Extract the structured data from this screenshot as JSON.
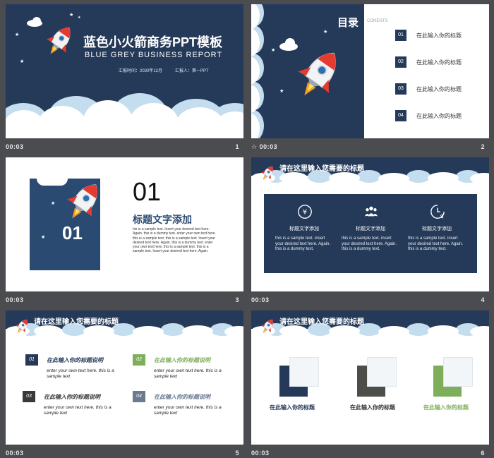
{
  "colors": {
    "navy": "#253a59",
    "cloud_blue": "#c4ddef",
    "green": "#7fae5b",
    "dark_gray": "#4d4d4a",
    "slate": "#6a7a90",
    "rocket_red": "#e53a30",
    "flame": "#f29b1e"
  },
  "slides": [
    {
      "time": "00:03",
      "number": "1",
      "title": "蓝色小火箭商务PPT模板",
      "subtitle": "BLUE GREY BUSINESS REPORT",
      "info_time": "汇报时间：2030年12月",
      "info_person": "汇报人：第一PPT"
    },
    {
      "time": "00:03",
      "number": "2",
      "heading": "目录",
      "contents_label": "CONENTS",
      "toc": [
        {
          "num": "01",
          "label": "在此输入你的标题"
        },
        {
          "num": "02",
          "label": "在此输入你的标题"
        },
        {
          "num": "03",
          "label": "在此输入你的标题"
        },
        {
          "num": "04",
          "label": "在此输入你的标题"
        }
      ]
    },
    {
      "time": "00:03",
      "number": "3",
      "big_number": "01",
      "panel_number": "01",
      "heading": "标题文字添加",
      "paragraph": "his is a sample text. Insert your desired text here. Again. this is a dummy text. enter your own text here. this is a sample text. this is a sample text. Insert your desired text here. Again. this is a dummy text. enter your own text here. this is a sample text. this is a sample text. Insert your desired text here. Again."
    },
    {
      "time": "00:03",
      "number": "4",
      "band_title": "请在这里输入您需要的标题",
      "columns": [
        {
          "icon": "yen-coin-icon",
          "title": "标题文字添加",
          "desc": "this is a sample text. insert your desired text here. Again. this is a dummy text."
        },
        {
          "icon": "people-group-icon",
          "title": "标题文字添加",
          "desc": "this is a sample text. insert your desired text here. Again. this is a dummy text."
        },
        {
          "icon": "dollar-clock-icon",
          "title": "标题文字添加",
          "desc": "this is a sample text. insert your desired text here. Again. this is a dummy text."
        }
      ]
    },
    {
      "time": "00:03",
      "number": "5",
      "band_title": "请在这里输入您需要的标题",
      "items": [
        {
          "num": "01",
          "title": "在此输入你的标题说明",
          "desc": "enter your own text here. this is a sample text",
          "color": "#253a59"
        },
        {
          "num": "02",
          "title": "在此输入你的标题说明",
          "desc": "enter your own text here. this is a sample text",
          "color": "#7fae5b"
        },
        {
          "num": "03",
          "title": "在此输入你的标题说明",
          "desc": "enter your own text here. this is a sample text",
          "color": "#3a3a3a"
        },
        {
          "num": "04",
          "title": "在此输入你的标题说明",
          "desc": "enter your own text here. this is a sample text",
          "color": "#6a7a90"
        }
      ]
    },
    {
      "time": "00:03",
      "number": "6",
      "band_title": "请在这里输入您需要的标题",
      "cards": [
        {
          "label": "在此输入你的标题",
          "color": "#253a59"
        },
        {
          "label": "在此输入你的标题",
          "color": "#4d4d4a"
        },
        {
          "label": "在此输入你的标题",
          "color": "#7fae5b"
        }
      ]
    }
  ]
}
